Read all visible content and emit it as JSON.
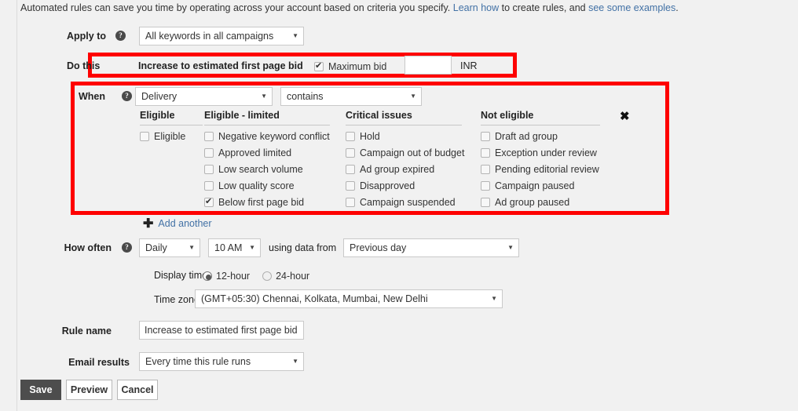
{
  "intro": {
    "text_before": "Automated rules can save you time by operating across your account based on criteria you specify. ",
    "link1": "Learn how",
    "text_middle": " to create rules, and ",
    "link2": "see some examples",
    "text_after": "."
  },
  "apply_to": {
    "label": "Apply to",
    "help": "?",
    "value": "All keywords in all campaigns",
    "caret": "▼"
  },
  "do_this": {
    "label": "Do this",
    "action": "Increase to estimated first page bid",
    "max_bid_label": "Maximum bid",
    "max_bid_checked": true,
    "max_bid_value": "",
    "currency": "INR"
  },
  "when": {
    "label": "When",
    "help": "?",
    "field": "Delivery",
    "operator": "contains",
    "caret": "▼",
    "close_icon": "✖",
    "columns": [
      {
        "header": "Eligible",
        "items": [
          {
            "label": "Eligible",
            "checked": false
          }
        ]
      },
      {
        "header": "Eligible - limited",
        "items": [
          {
            "label": "Negative keyword conflict",
            "checked": false
          },
          {
            "label": "Approved limited",
            "checked": false
          },
          {
            "label": "Low search volume",
            "checked": false
          },
          {
            "label": "Low quality score",
            "checked": false
          },
          {
            "label": "Below first page bid",
            "checked": true
          }
        ]
      },
      {
        "header": "Critical issues",
        "items": [
          {
            "label": "Hold",
            "checked": false
          },
          {
            "label": "Campaign out of budget",
            "checked": false
          },
          {
            "label": "Ad group expired",
            "checked": false
          },
          {
            "label": "Disapproved",
            "checked": false
          },
          {
            "label": "Campaign suspended",
            "checked": false
          }
        ]
      },
      {
        "header": "Not eligible",
        "items": [
          {
            "label": "Draft ad group",
            "checked": false
          },
          {
            "label": "Exception under review",
            "checked": false
          },
          {
            "label": "Pending editorial review",
            "checked": false
          },
          {
            "label": "Campaign paused",
            "checked": false
          },
          {
            "label": "Ad group paused",
            "checked": false
          }
        ]
      }
    ]
  },
  "add_another": {
    "plus": "✚",
    "label": "Add another"
  },
  "how_often": {
    "label": "How often",
    "help": "?",
    "frequency": "Daily",
    "time": "10 AM",
    "using_data_from_label": "using data from",
    "data_range": "Previous day",
    "display_time_label": "Display time:",
    "display_options": [
      {
        "label": "12-hour",
        "selected": true
      },
      {
        "label": "24-hour",
        "selected": false
      }
    ],
    "time_zone_label": "Time zone:",
    "time_zone": "(GMT+05:30) Chennai, Kolkata, Mumbai, New Delhi",
    "caret": "▼"
  },
  "rule_name": {
    "label": "Rule name",
    "value": "Increase to estimated first page bid"
  },
  "email_results": {
    "label": "Email results",
    "value": "Every time this rule runs",
    "caret": "▼"
  },
  "buttons": {
    "save": "Save",
    "preview": "Preview",
    "cancel": "Cancel"
  },
  "colors": {
    "highlight": "#fe0000",
    "link": "#4271a5",
    "primary_button": "#4d4d4d"
  }
}
